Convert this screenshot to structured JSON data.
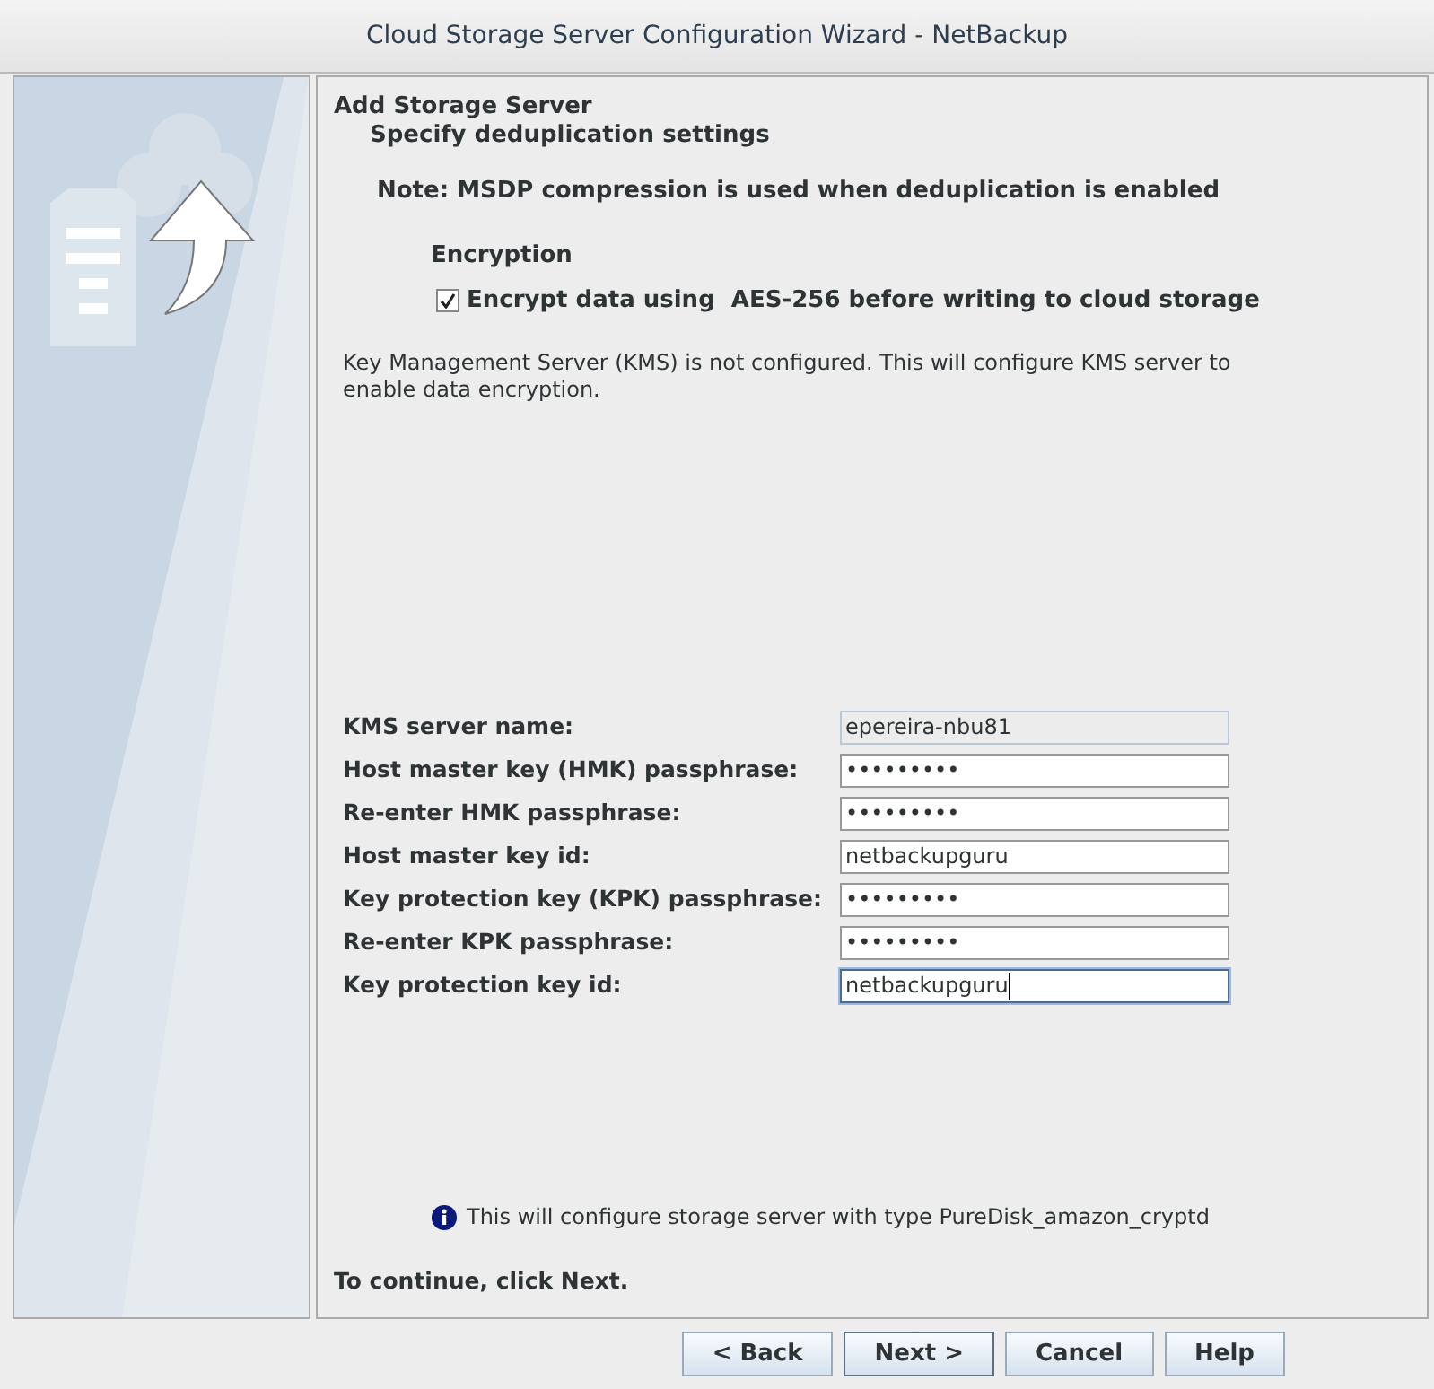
{
  "window": {
    "title": "Cloud Storage Server Configuration Wizard - NetBackup"
  },
  "header": {
    "title": "Add Storage Server",
    "subtitle": "Specify deduplication settings"
  },
  "note": "Note: MSDP compression is used when deduplication is enabled",
  "encryption": {
    "heading": "Encryption",
    "checkbox": {
      "label": "Encrypt data using  AES-256 before writing to cloud storage",
      "checked": true
    }
  },
  "kms_message": "Key Management Server (KMS) is not configured. This will configure KMS server to enable data encryption.",
  "fields": [
    {
      "label": "KMS server name:",
      "value": "epereira-nbu81",
      "disabled": true,
      "focused": false
    },
    {
      "label": "Host master key (HMK) passphrase:",
      "value": "•••••••••",
      "disabled": false,
      "focused": false
    },
    {
      "label": "Re-enter HMK passphrase:",
      "value": "•••••••••",
      "disabled": false,
      "focused": false
    },
    {
      "label": "Host master key id:",
      "value": "netbackupguru",
      "disabled": false,
      "focused": false
    },
    {
      "label": "Key protection key (KPK) passphrase:",
      "value": "•••••••••",
      "disabled": false,
      "focused": false
    },
    {
      "label": "Re-enter KPK passphrase:",
      "value": "•••••••••",
      "disabled": false,
      "focused": false
    },
    {
      "label": "Key protection key id:",
      "value": "netbackupguru",
      "disabled": false,
      "focused": true
    }
  ],
  "info": "This will configure storage server with type PureDisk_amazon_cryptd",
  "continue_hint": "To continue, click Next.",
  "buttons": [
    {
      "label": "< Back",
      "selected": false
    },
    {
      "label": "Next >",
      "selected": true
    },
    {
      "label": "Cancel",
      "selected": false
    },
    {
      "label": "Help",
      "selected": false
    }
  ]
}
